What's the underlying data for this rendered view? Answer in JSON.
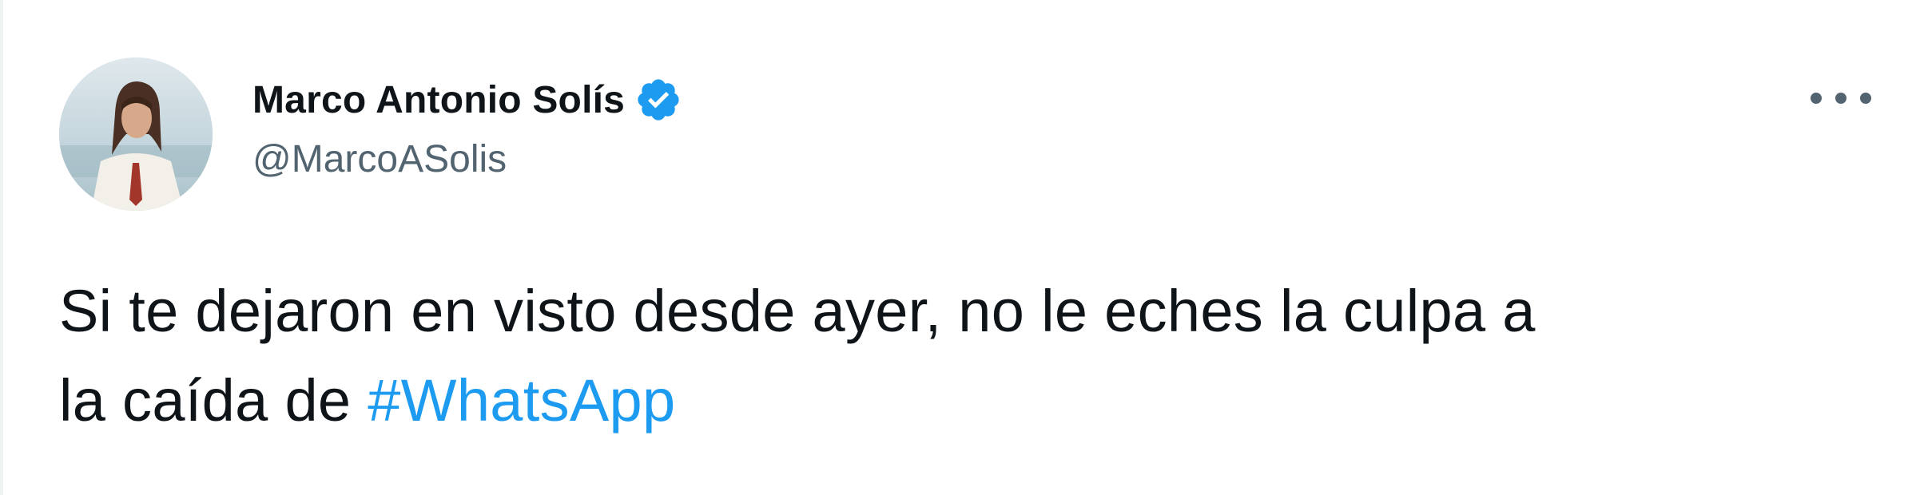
{
  "tweet": {
    "author": {
      "display_name": "Marco Antonio Solís",
      "handle": "@MarcoASolis",
      "verified": true,
      "avatar_icon": "profile-photo"
    },
    "more_icon": "more-options-icon",
    "text": {
      "line1": "Si te dejaron en visto desde ayer, no le eches la culpa a",
      "line2_prefix": "la caída de ",
      "hashtag": "#WhatsApp"
    }
  },
  "colors": {
    "text_primary": "#0f1419",
    "text_secondary": "#536471",
    "link": "#1d9bf0",
    "verified_badge": "#1d9bf0",
    "border": "#eff3f4"
  }
}
